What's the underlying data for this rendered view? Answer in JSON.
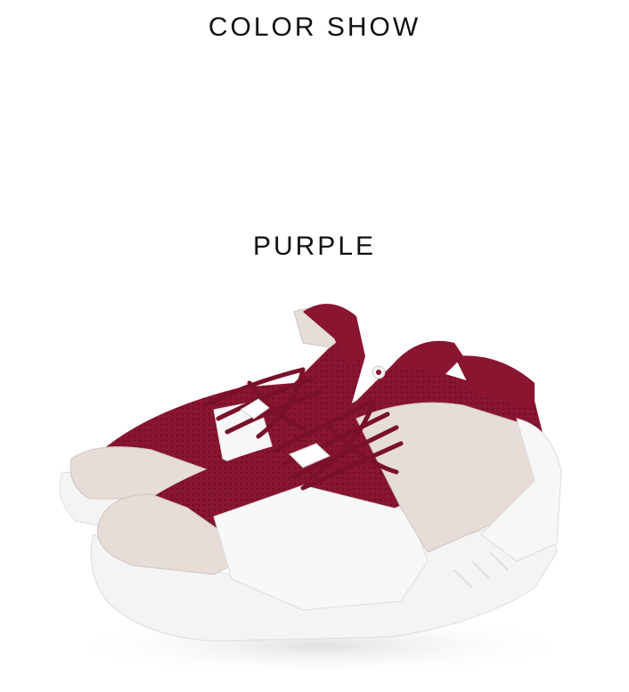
{
  "page": {
    "title": "COLOR SHOW",
    "color_name": "PURPLE"
  },
  "product": {
    "image_subject": "pair of sneakers",
    "colors": {
      "accent": "#8a1531",
      "suede": "#e6dcd8",
      "leather": "#f7f7f7",
      "background": "#ffffff"
    }
  }
}
